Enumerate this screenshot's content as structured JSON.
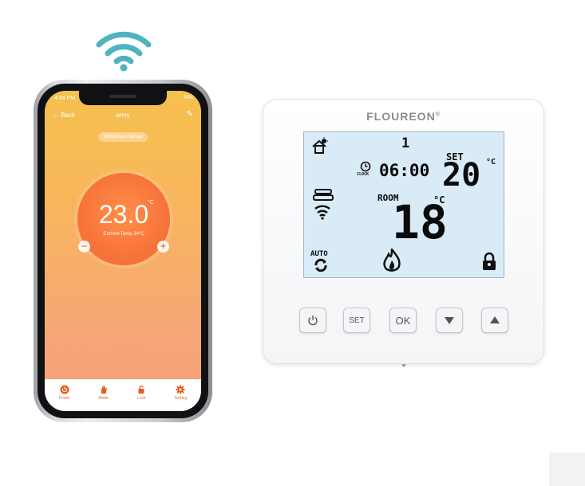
{
  "phone": {
    "status_time": "4:04 PM",
    "status_battery": "54%",
    "nav_back": "← Back",
    "nav_title": "anny",
    "edit_icon": "pencil-icon",
    "mode_pill": "Temporary manual",
    "setpoint": "23.0",
    "setpoint_unit": "°C",
    "current_temp": "Current Temp 34°C",
    "minus": "−",
    "plus": "+",
    "tabs": [
      {
        "label": "Power",
        "icon": "power-icon"
      },
      {
        "label": "Mode",
        "icon": "hand-icon"
      },
      {
        "label": "Lock",
        "icon": "lock-icon"
      },
      {
        "label": "Setting",
        "icon": "gear-icon"
      }
    ],
    "colors": {
      "accent": "#f07a3a",
      "gradient_top": "#f6c04d",
      "gradient_bottom": "#f5a07e"
    }
  },
  "thermostat": {
    "brand": "FLOUREON",
    "brand_mark": "®",
    "lcd": {
      "program_number": "1",
      "clock_label": "CLOCK",
      "clock_time": "06:00",
      "set_label": "SET",
      "set_temp": "20",
      "set_unit": "°C",
      "room_label": "ROOM",
      "room_temp": "18",
      "room_unit": "°C",
      "auto_label": "AUTO"
    },
    "keys": [
      {
        "label": "",
        "icon": "power-icon"
      },
      {
        "label": "SET",
        "icon": ""
      },
      {
        "label": "OK",
        "icon": ""
      },
      {
        "label": "",
        "icon": "down-arrow-icon"
      },
      {
        "label": "",
        "icon": "up-arrow-icon"
      }
    ]
  },
  "wifi_icon": "wifi-icon"
}
